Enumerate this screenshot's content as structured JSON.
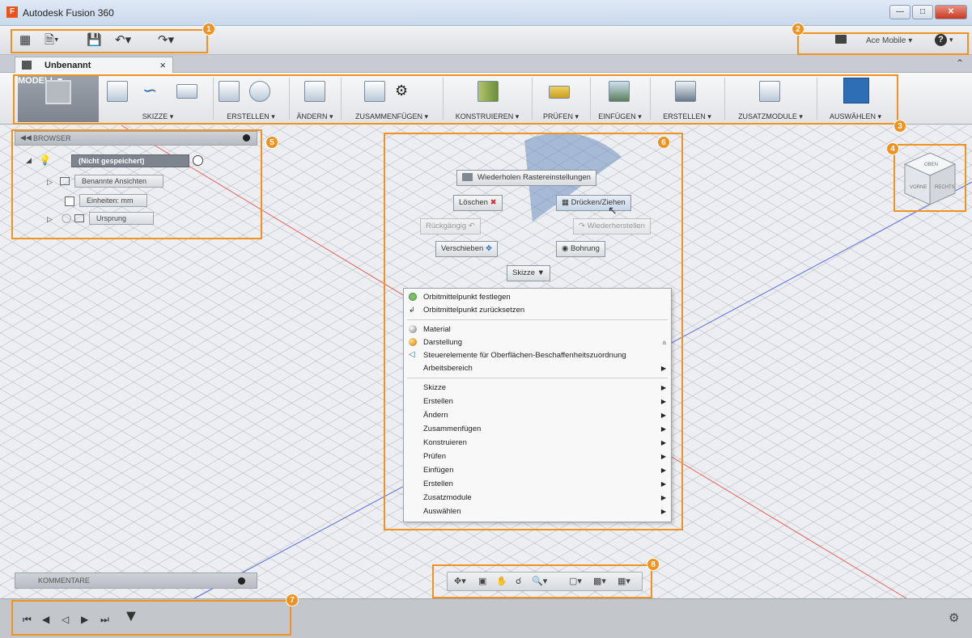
{
  "window": {
    "title": "Autodesk Fusion 360",
    "logo_letter": "F"
  },
  "quick_access": {
    "account_label": "Ace Mobile ▾",
    "help_label": "?",
    "icons": [
      "apps-grid-icon",
      "file-icon",
      "save-icon",
      "undo-icon",
      "redo-icon"
    ]
  },
  "tab": {
    "label": "Unbenannt",
    "close": "×"
  },
  "toolbar": {
    "modell": "MODELL ▾",
    "skizze": "SKIZZE ▾",
    "erstellen": "ERSTELLEN ▾",
    "aendern": "ÄNDERN ▾",
    "zusammenfuegen": "ZUSAMMENFÜGEN ▾",
    "konstruieren": "KONSTRUIEREN ▾",
    "pruefen": "PRÜFEN ▾",
    "einfuegen": "EINFÜGEN ▾",
    "erstellen2": "ERSTELLEN ▾",
    "zusatzmodule": "ZUSATZMODULE ▾",
    "auswaehlen": "AUSWÄHLEN ▾"
  },
  "browser": {
    "title": "BROWSER",
    "root": "(Nicht gespeichert)",
    "items": [
      "Benannte Ansichten",
      "Einheiten: mm",
      "Ursprung"
    ]
  },
  "kommentare": {
    "title": "KOMMENTARE"
  },
  "viewcube": {
    "top": "OBEN",
    "front": "VORNE",
    "right": "RECHTS"
  },
  "marking_menu": {
    "repeat": "Wiederholen Rastereinstellungen",
    "delete": "Löschen",
    "press_pull": "Drücken/Ziehen",
    "undo": "Rückgängig",
    "redo": "Wiederherstellen",
    "move": "Verschieben",
    "hole": "Bohrung",
    "sketch": "Skizze ▼"
  },
  "context_menu": {
    "orbit_set": "Orbitmittelpunkt festlegen",
    "orbit_reset": "Orbitmittelpunkt zurücksetzen",
    "material": "Material",
    "appearance": "Darstellung",
    "appearance_shortcut": "a",
    "texture": "Steuerelemente für Oberflächen-Beschaffenheitszuordnung",
    "workspace": "Arbeitsbereich",
    "submenus": [
      "Skizze",
      "Erstellen",
      "Ändern",
      "Zusammenfügen",
      "Konstruieren",
      "Prüfen",
      "Einfügen",
      "Erstellen",
      "Zusatzmodule",
      "Auswählen"
    ]
  },
  "callouts": [
    "1",
    "2",
    "3",
    "4",
    "5",
    "6",
    "7",
    "8"
  ],
  "colors": {
    "highlight": "#f0921f",
    "axis_red": "#e8615a",
    "axis_blue": "#5a6de8",
    "select_blue": "#2e6eb5"
  }
}
